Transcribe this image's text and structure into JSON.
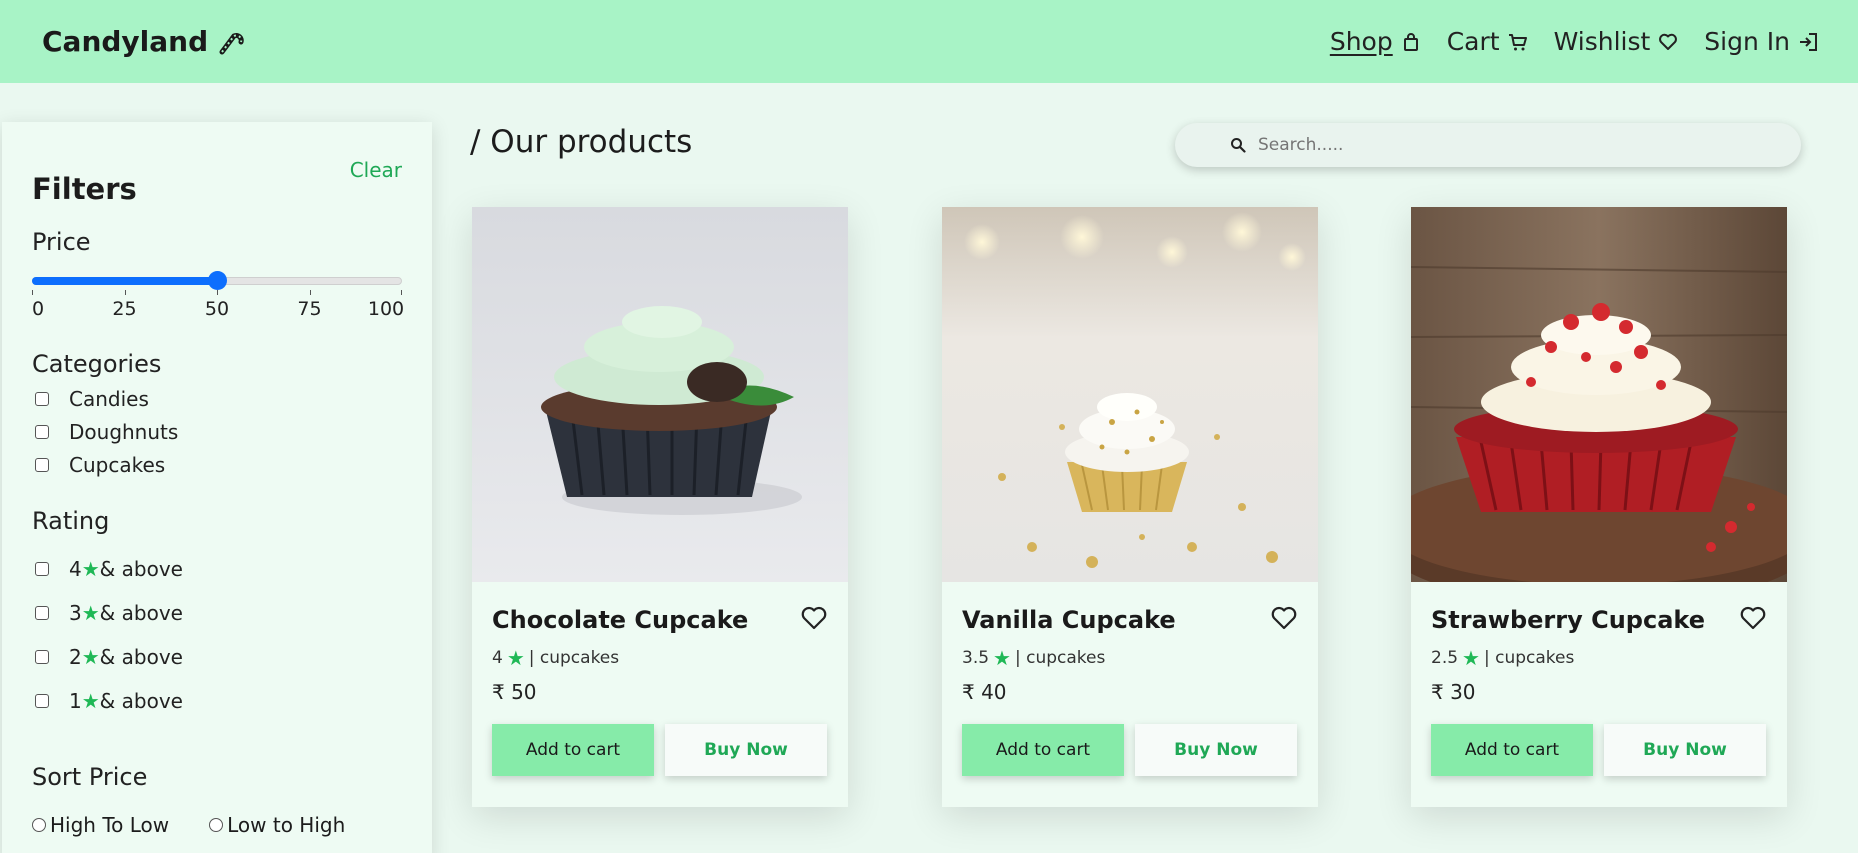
{
  "header": {
    "brand": "Candyland",
    "nav": [
      {
        "label": "Shop",
        "icon": "shopping-bag-icon"
      },
      {
        "label": "Cart",
        "icon": "cart-icon"
      },
      {
        "label": "Wishlist",
        "icon": "heart-icon"
      },
      {
        "label": "Sign In",
        "icon": "sign-in-icon"
      }
    ]
  },
  "sidebar": {
    "title": "Filters",
    "clear_label": "Clear",
    "price": {
      "title": "Price",
      "value": 50,
      "min": 0,
      "max": 100,
      "tick_labels": [
        "0",
        "25",
        "50",
        "75",
        "100"
      ]
    },
    "categories": {
      "title": "Categories",
      "items": [
        "Candies",
        "Doughnuts",
        "Cupcakes"
      ]
    },
    "rating": {
      "title": "Rating",
      "items": [
        {
          "value": "4",
          "suffix": "& above"
        },
        {
          "value": "3",
          "suffix": "& above"
        },
        {
          "value": "2",
          "suffix": "& above"
        },
        {
          "value": "1",
          "suffix": "& above"
        }
      ]
    },
    "sort": {
      "title": "Sort Price",
      "options": [
        "High To Low",
        "Low to High"
      ]
    }
  },
  "main": {
    "title": "/ Our products",
    "search_placeholder": "Search.....",
    "products": [
      {
        "name": "Chocolate Cupcake",
        "rating": "4",
        "category": "| cupcakes",
        "price": "₹ 50",
        "add_label": "Add to cart",
        "buy_label": "Buy Now"
      },
      {
        "name": "Vanilla Cupcake",
        "rating": "3.5",
        "category": "| cupcakes",
        "price": "₹ 40",
        "add_label": "Add to cart",
        "buy_label": "Buy Now"
      },
      {
        "name": "Strawberry Cupcake",
        "rating": "2.5",
        "category": "| cupcakes",
        "price": "₹ 30",
        "add_label": "Add to cart",
        "buy_label": "Buy Now"
      }
    ]
  },
  "colors": {
    "header_bg": "#a8f3c6",
    "accent_green": "#1fa856",
    "slider_blue": "#0d6efd",
    "cart_button": "#86eba9"
  }
}
